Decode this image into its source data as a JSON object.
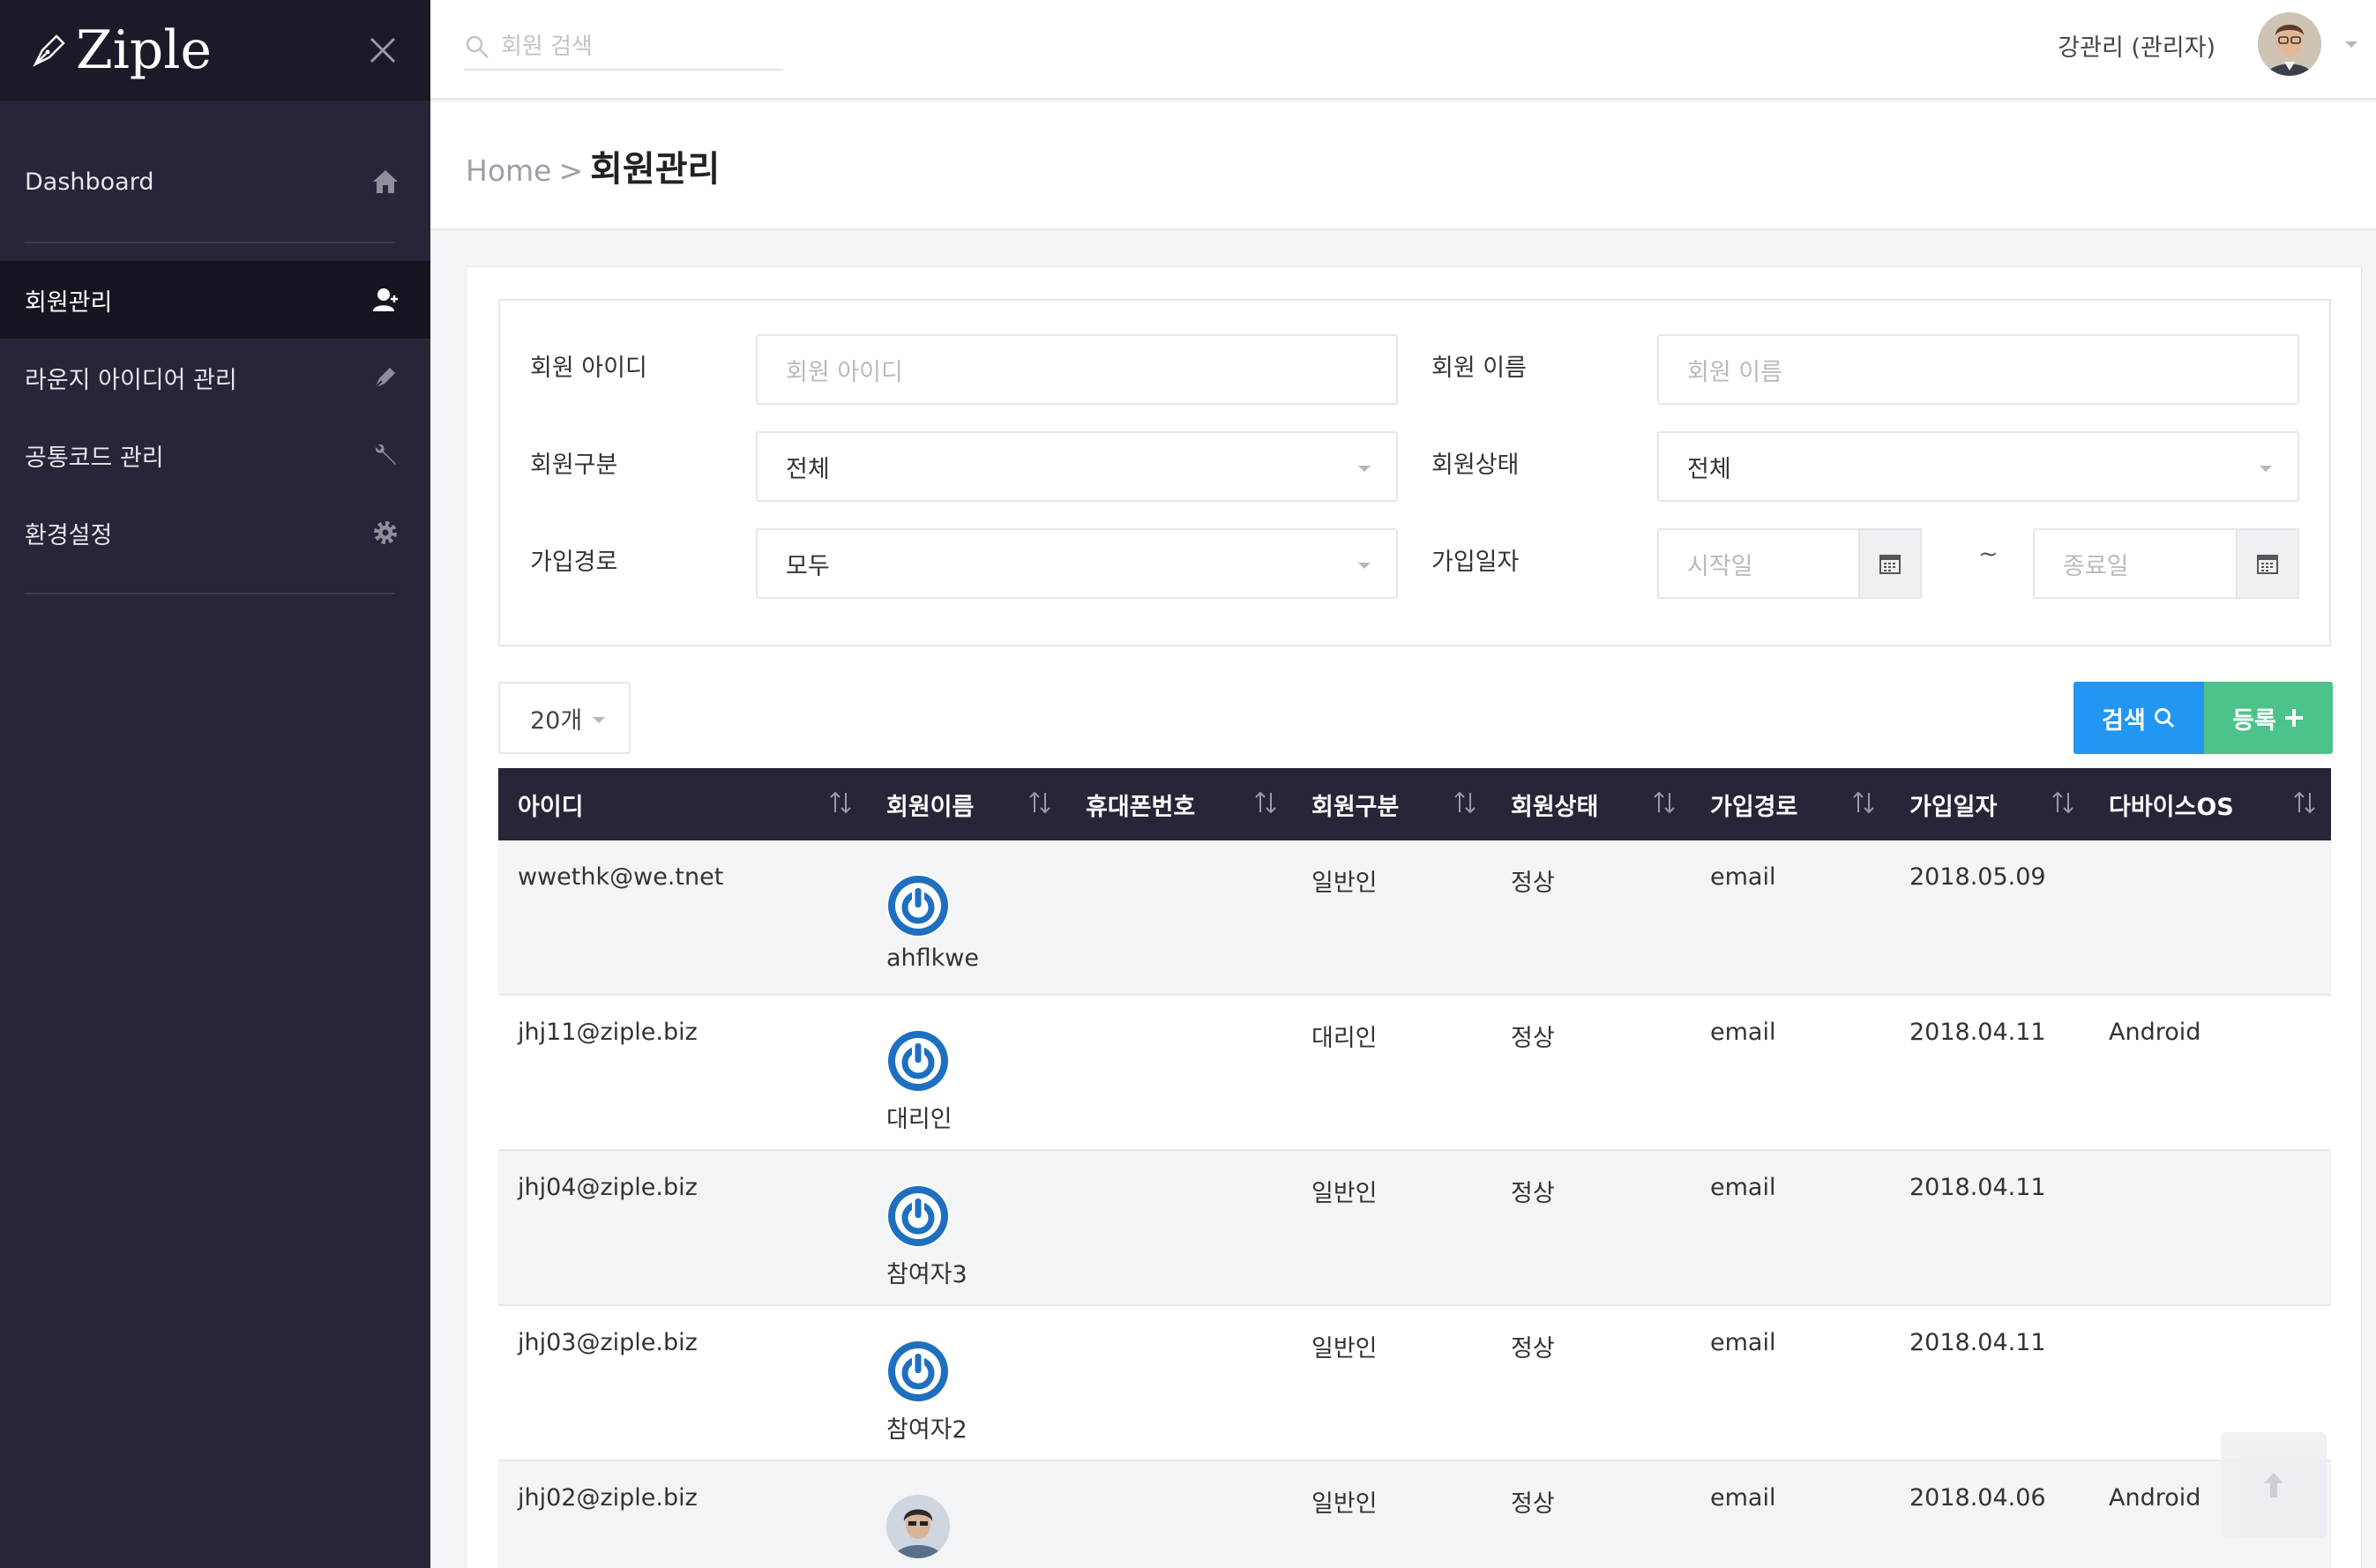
{
  "app": {
    "logo_text": "Ziple"
  },
  "header": {
    "search_placeholder": "회원 검색",
    "user_name": "강관리 (관리자)"
  },
  "sidebar": {
    "items": [
      {
        "label": "Dashboard",
        "icon": "home-icon",
        "active": false
      },
      {
        "label": "회원관리",
        "icon": "user-icon",
        "active": true
      },
      {
        "label": "라운지 아이디어 관리",
        "icon": "pen-icon",
        "active": false
      },
      {
        "label": "공통코드 관리",
        "icon": "wrench-icon",
        "active": false
      },
      {
        "label": "환경설정",
        "icon": "gear-icon",
        "active": false
      }
    ]
  },
  "breadcrumb": {
    "home": "Home",
    "separator": ">",
    "current": "회원관리"
  },
  "filters": {
    "member_id": {
      "label": "회원 아이디",
      "placeholder": "회원 아이디"
    },
    "member_name": {
      "label": "회원 이름",
      "placeholder": "회원 이름"
    },
    "member_type": {
      "label": "회원구분",
      "value": "전체"
    },
    "member_status": {
      "label": "회원상태",
      "value": "전체"
    },
    "join_route": {
      "label": "가입경로",
      "value": "모두"
    },
    "join_date": {
      "label": "가입일자",
      "start_placeholder": "시작일",
      "end_placeholder": "종료일",
      "separator": "~"
    }
  },
  "toolbar": {
    "page_size": "20개",
    "search_label": "검색",
    "add_label": "등록"
  },
  "table": {
    "columns": [
      "아이디",
      "회원이름",
      "휴대폰번호",
      "회원구분",
      "회원상태",
      "가입경로",
      "가입일자",
      "다바이스OS"
    ],
    "rows": [
      {
        "id": "wwethk@we.tnet",
        "name": "ahflkwe",
        "avatar": "power-icon",
        "phone": "",
        "type": "일반인",
        "status": "정상",
        "route": "email",
        "date": "2018.05.09",
        "os": ""
      },
      {
        "id": "jhj11@ziple.biz",
        "name": "대리인",
        "avatar": "power-icon",
        "phone": "",
        "type": "대리인",
        "status": "정상",
        "route": "email",
        "date": "2018.04.11",
        "os": "Android"
      },
      {
        "id": "jhj04@ziple.biz",
        "name": "참여자3",
        "avatar": "power-icon",
        "phone": "",
        "type": "일반인",
        "status": "정상",
        "route": "email",
        "date": "2018.04.11",
        "os": ""
      },
      {
        "id": "jhj03@ziple.biz",
        "name": "참여자2",
        "avatar": "power-icon",
        "phone": "",
        "type": "일반인",
        "status": "정상",
        "route": "email",
        "date": "2018.04.11",
        "os": ""
      },
      {
        "id": "jhj02@ziple.biz",
        "name": "",
        "avatar": "photo",
        "phone": "",
        "type": "일반인",
        "status": "정상",
        "route": "email",
        "date": "2018.04.06",
        "os": "Android"
      }
    ]
  },
  "colors": {
    "sidebar": "#272537",
    "sidebar_top": "#1c1a29",
    "search_btn": "#2196f3",
    "add_btn": "#4cc38a",
    "avatar_ring": "#1e6fc0"
  }
}
